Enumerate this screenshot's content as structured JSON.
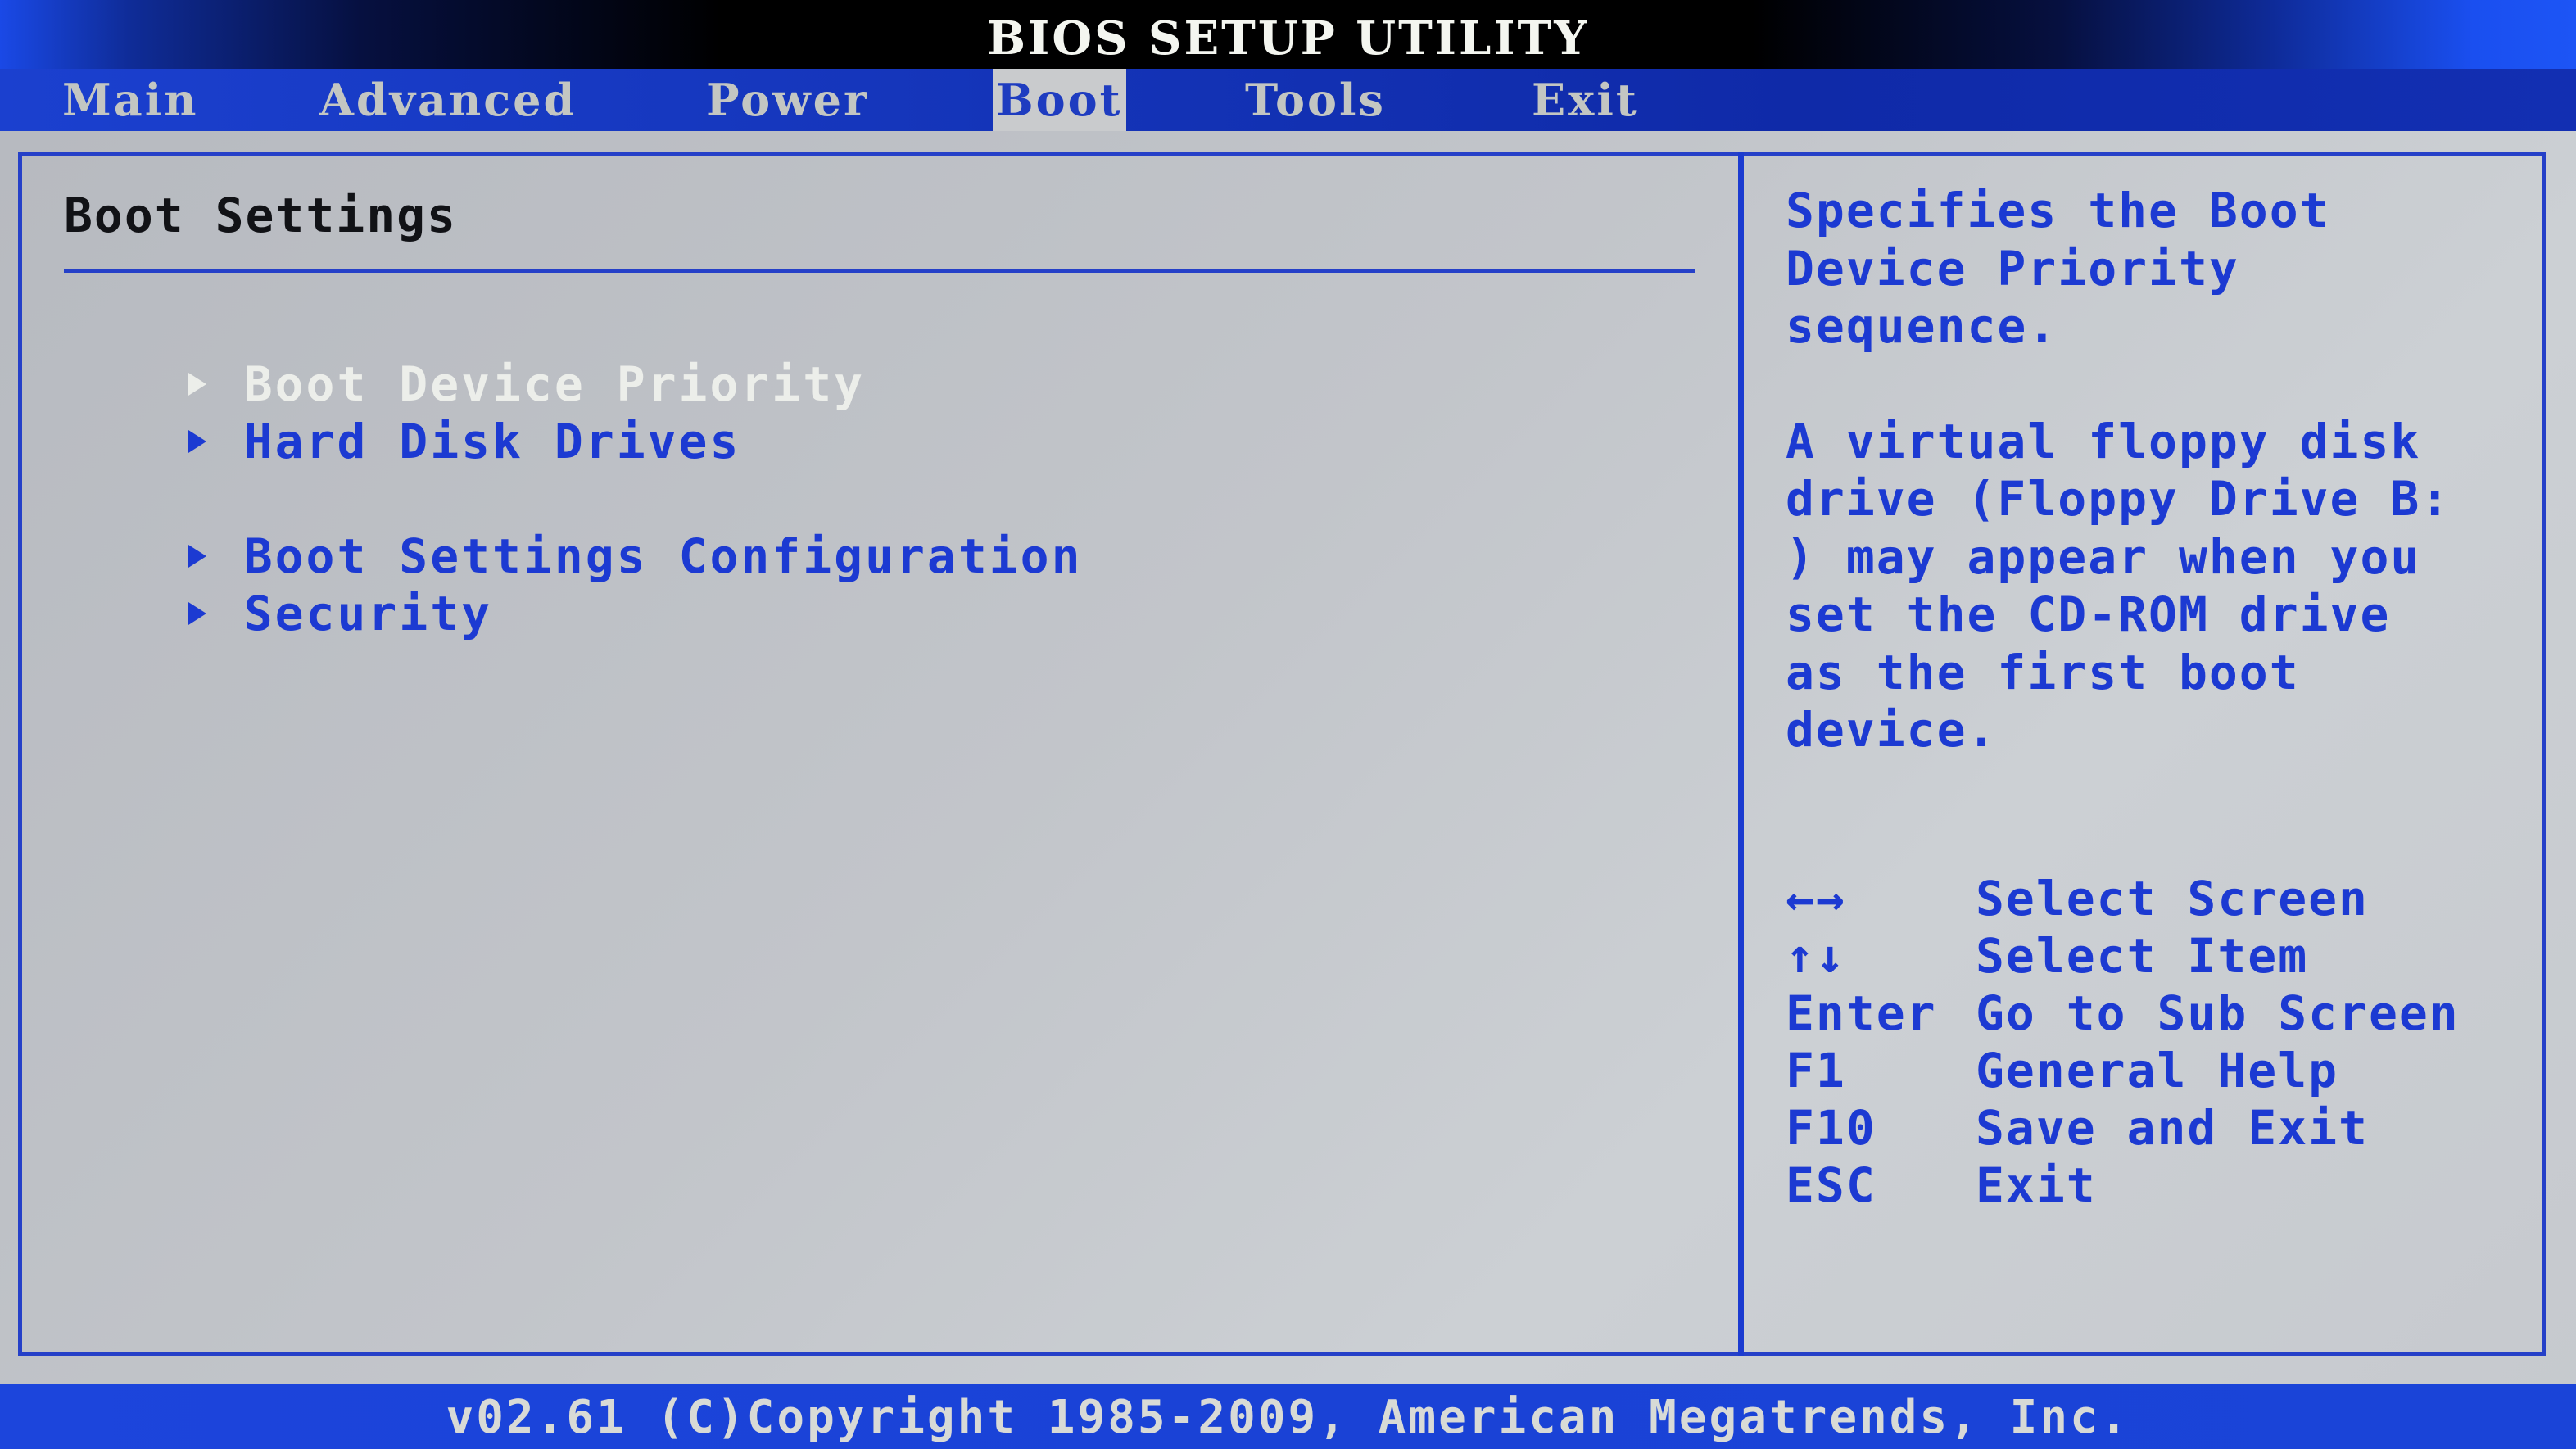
{
  "header": {
    "title": "BIOS SETUP UTILITY"
  },
  "tabs": [
    {
      "label": "Main",
      "selected": false
    },
    {
      "label": "Advanced",
      "selected": false
    },
    {
      "label": "Power",
      "selected": false
    },
    {
      "label": "Boot",
      "selected": true
    },
    {
      "label": "Tools",
      "selected": false
    },
    {
      "label": "Exit",
      "selected": false
    }
  ],
  "main": {
    "section_title": "Boot Settings",
    "items": [
      {
        "label": "Boot Device Priority",
        "icon": "submenu-arrow-icon",
        "highlighted": true
      },
      {
        "label": "Hard Disk Drives",
        "icon": "submenu-arrow-icon",
        "highlighted": false
      },
      {
        "label": "Boot Settings Configuration",
        "icon": "submenu-arrow-icon",
        "highlighted": false
      },
      {
        "label": "Security",
        "icon": "submenu-arrow-icon",
        "highlighted": false
      }
    ]
  },
  "help": {
    "paragraph1": [
      "Specifies the Boot",
      "Device Priority",
      "sequence."
    ],
    "paragraph2": [
      "A virtual floppy disk",
      "drive (Floppy Drive B:",
      ") may appear when you",
      "set the CD-ROM drive",
      "as the first boot",
      "device."
    ]
  },
  "keys": [
    {
      "key": "←→",
      "action": "Select Screen"
    },
    {
      "key": "↑↓",
      "action": "Select Item"
    },
    {
      "key": "Enter",
      "action": "Go to Sub Screen"
    },
    {
      "key": "F1",
      "action": "General Help"
    },
    {
      "key": "F10",
      "action": "Save and Exit"
    },
    {
      "key": "ESC",
      "action": "Exit"
    }
  ],
  "footer": {
    "text": "v02.61 (C)Copyright 1985-2009, American Megatrends, Inc."
  },
  "colors": {
    "accent_blue": "#1c3ad2",
    "highlight_text": "#eceeea",
    "panel_gray": "#c2c5ca",
    "title_black": "#000000"
  }
}
